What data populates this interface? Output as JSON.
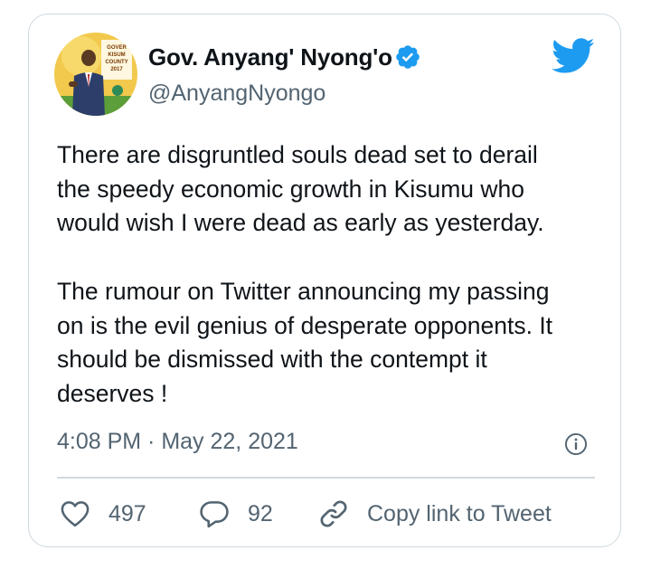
{
  "author": {
    "name": "Gov. Anyang' Nyong'o",
    "handle": "@AnyangNyongo",
    "verified": true,
    "avatar_icon": "profile-photo"
  },
  "tweet": {
    "paragraph1": [
      "There are disgruntled souls dead set to derail",
      "the speedy economic growth in Kisumu who",
      "would wish I were dead as early as yesterday."
    ],
    "paragraph2": [
      "The rumour on Twitter announcing my passing",
      "on is the evil genius of desperate opponents. It",
      "should be dismissed with the contempt it",
      "deserves !"
    ],
    "timestamp": "4:08 PM · May 22, 2021"
  },
  "actions": {
    "likes": "497",
    "replies": "92",
    "copy_link_label": "Copy link to Tweet"
  },
  "colors": {
    "brand_blue": "#1d9bf0",
    "secondary_text": "#536471",
    "border": "#cfd9de"
  }
}
